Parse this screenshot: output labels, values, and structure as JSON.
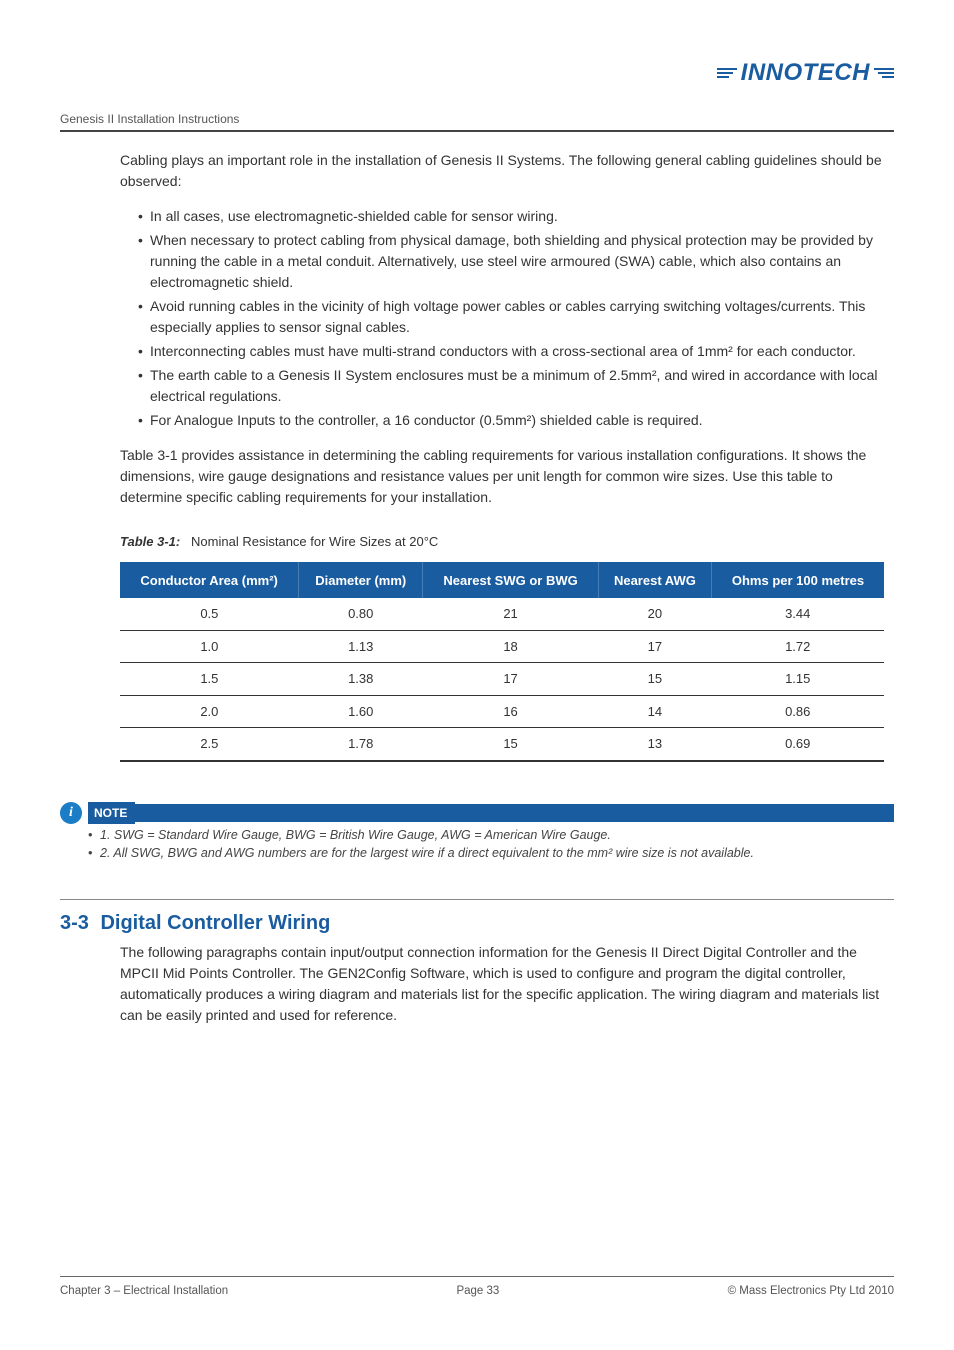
{
  "logo": {
    "text": "INNOTECH"
  },
  "header": {
    "doc_title": "Genesis II Installation Instructions"
  },
  "intro": "Cabling plays an important role in the installation of Genesis II Systems.  The following general cabling guidelines should be observed:",
  "bullets": [
    "In all cases, use electromagnetic-shielded cable for sensor wiring.",
    "When necessary to protect cabling from physical damage, both shielding and physical protection may be provided by running the cable in a metal conduit.  Alternatively, use steel wire armoured (SWA) cable, which also contains an electromagnetic shield.",
    "Avoid running cables in the vicinity of high voltage power cables or cables carrying switching voltages/currents.  This especially applies to sensor signal cables.",
    "Interconnecting cables must have multi-strand conductors with a cross-sectional area of 1mm² for each conductor.",
    "The earth cable to a Genesis II System enclosures must be a minimum of 2.5mm², and wired in accordance with local electrical regulations.",
    "For Analogue Inputs to the controller, a 16 conductor (0.5mm²) shielded cable is required."
  ],
  "after_bullets": "Table 3-1 provides assistance in determining the cabling requirements for various installation configurations.  It shows the dimensions, wire gauge designations and resistance values per unit length for common wire sizes.  Use this table to determine specific cabling requirements for your installation.",
  "table": {
    "caption_label": "Table 3-1:",
    "caption_text": "Nominal Resistance for Wire Sizes at 20°C",
    "headers": [
      "Conductor Area (mm²)",
      "Diameter (mm)",
      "Nearest SWG or BWG",
      "Nearest AWG",
      "Ohms per 100 metres"
    ],
    "rows": [
      [
        "0.5",
        "0.80",
        "21",
        "20",
        "3.44"
      ],
      [
        "1.0",
        "1.13",
        "18",
        "17",
        "1.72"
      ],
      [
        "1.5",
        "1.38",
        "17",
        "15",
        "1.15"
      ],
      [
        "2.0",
        "1.60",
        "16",
        "14",
        "0.86"
      ],
      [
        "2.5",
        "1.78",
        "15",
        "13",
        "0.69"
      ]
    ]
  },
  "note": {
    "label": "NOTE",
    "items": [
      "1. SWG = Standard Wire Gauge, BWG = British Wire Gauge, AWG = American Wire Gauge.",
      "2. All SWG, BWG and AWG numbers are for the largest wire if a direct equivalent to the mm² wire size is not available."
    ]
  },
  "section": {
    "number": "3-3",
    "title": "Digital Controller Wiring",
    "body": "The following paragraphs contain input/output connection information for the Genesis II Direct Digital Controller and the MPCII Mid Points Controller.  The GEN2Config Software, which is used to configure and program the digital controller, automatically produces a wiring diagram and materials list for the specific application.  The wiring diagram and materials list can be easily printed and used for reference."
  },
  "footer": {
    "left": "Chapter 3 – Electrical Installation",
    "center": "Page 33",
    "right": "© Mass Electronics Pty Ltd  2010"
  },
  "chart_data": {
    "type": "table",
    "title": "Nominal Resistance for Wire Sizes at 20°C",
    "columns": [
      "Conductor Area (mm²)",
      "Diameter (mm)",
      "Nearest SWG or BWG",
      "Nearest AWG",
      "Ohms per 100 metres"
    ],
    "rows": [
      [
        0.5,
        0.8,
        21,
        20,
        3.44
      ],
      [
        1.0,
        1.13,
        18,
        17,
        1.72
      ],
      [
        1.5,
        1.38,
        17,
        15,
        1.15
      ],
      [
        2.0,
        1.6,
        16,
        14,
        0.86
      ],
      [
        2.5,
        1.78,
        15,
        13,
        0.69
      ]
    ]
  }
}
